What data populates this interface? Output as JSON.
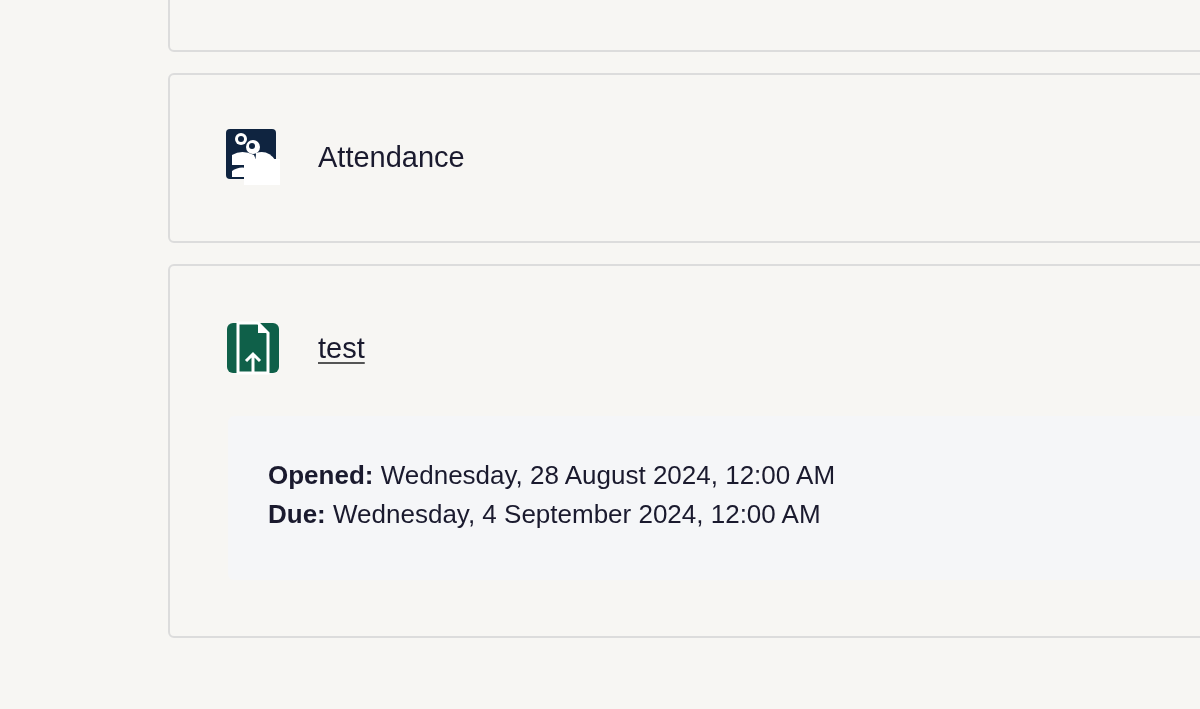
{
  "activities": [
    {
      "kind": "attendance",
      "title": "Attendance",
      "link": false
    },
    {
      "kind": "assignment",
      "title": "test",
      "link": true,
      "dates": [
        {
          "label": "Opened:",
          "value": "Wednesday, 28 August 2024, 12:00 AM"
        },
        {
          "label": "Due:",
          "value": "Wednesday, 4 September 2024, 12:00 AM"
        }
      ]
    }
  ]
}
